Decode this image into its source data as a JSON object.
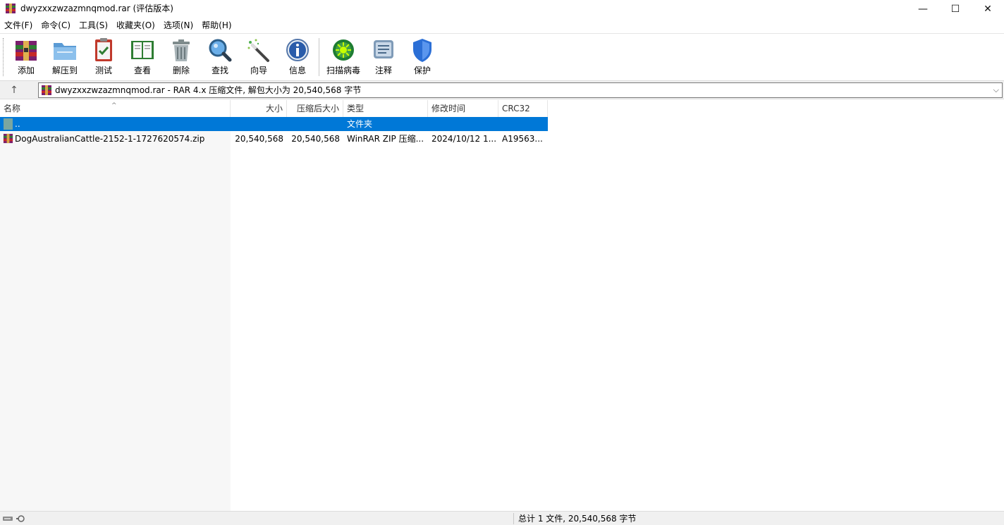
{
  "window": {
    "title": "dwyzxxzwzazmnqmod.rar (评估版本)",
    "minimize_glyph": "—",
    "maximize_glyph": "☐",
    "close_glyph": "✕"
  },
  "menu": [
    "文件(F)",
    "命令(C)",
    "工具(S)",
    "收藏夹(O)",
    "选项(N)",
    "帮助(H)"
  ],
  "toolbar": {
    "add": "添加",
    "extract": "解压到",
    "test": "测试",
    "view": "查看",
    "delete": "删除",
    "find": "查找",
    "wizard": "向导",
    "info": "信息",
    "virusscan": "扫描病毒",
    "comment": "注释",
    "protect": "保护"
  },
  "address": {
    "up_glyph": "↑",
    "text": "dwyzxxzwzazmnqmod.rar - RAR 4.x 压缩文件, 解包大小为 20,540,568 字节",
    "dropdown_glyph": "⌵"
  },
  "columns": {
    "name": "名称",
    "size": "大小",
    "packed": "压缩后大小",
    "type": "类型",
    "modified": "修改时间",
    "crc": "CRC32",
    "sort_glyph": "^"
  },
  "rows": [
    {
      "name": "..",
      "size": "",
      "packed": "",
      "type": "文件夹",
      "modified": "",
      "crc": "",
      "selected": true
    },
    {
      "name": "DogAustralianCattle-2152-1-1727620574.zip",
      "size": "20,540,568",
      "packed": "20,540,568",
      "type": "WinRAR ZIP 压缩...",
      "modified": "2024/10/12 1...",
      "crc": "A19563...",
      "selected": false
    }
  ],
  "status": {
    "summary": "总计 1 文件, 20,540,568 字节"
  },
  "colors": {
    "selection": "#0078d7",
    "left_pane": "#f7f7f7"
  }
}
